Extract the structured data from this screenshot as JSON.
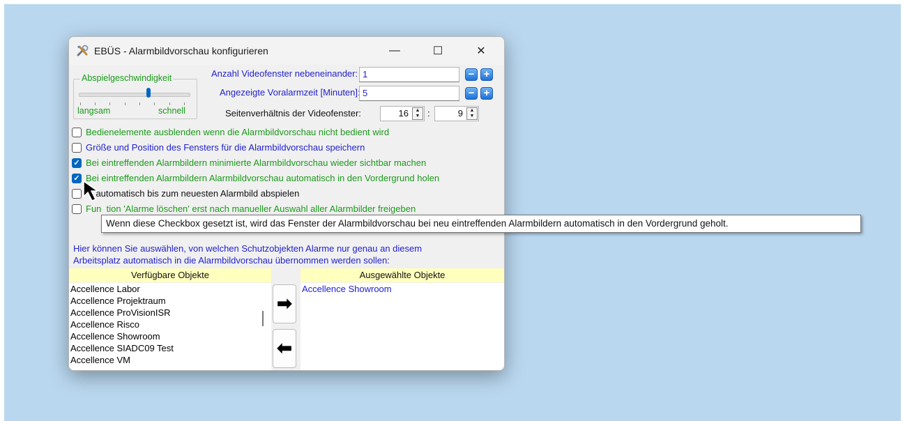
{
  "window": {
    "title": "EBÜS - Alarmbildvorschau konfigurieren",
    "minimize_label": "—",
    "maximize_label": "☐",
    "close_label": "✕"
  },
  "playback": {
    "group_label": "Abspielgeschwindigkeit",
    "slow_label": "langsam",
    "fast_label": "schnell",
    "slider_value_fraction": 0.63
  },
  "fields": {
    "video_windows_label": "Anzahl Videofenster nebeneinander:",
    "video_windows_value": "1",
    "prealarm_label": "Angezeigte Voralarmzeit [Minuten]:",
    "prealarm_value": "5",
    "aspect_label": "Seitenverhältnis der Videofenster:",
    "aspect_width": "16",
    "aspect_sep": ":",
    "aspect_height": "9",
    "minus_label": "−",
    "plus_label": "+"
  },
  "checkboxes": [
    {
      "label": "Bedienelemente ausblenden wenn die Alarmbildvorschau nicht bedient wird",
      "checked": false,
      "color": "green"
    },
    {
      "label": "Größe und Position des Fensters für die Alarmbildvorschau speichern",
      "checked": false,
      "color": "blue"
    },
    {
      "label": "Bei eintreffenden Alarmbildern minimierte Alarmbildvorschau wieder sichtbar machen",
      "checked": true,
      "color": "green"
    },
    {
      "label": "Bei eintreffenden Alarmbildern Alarmbildvorschau automatisch in den Vordergrund holen",
      "checked": true,
      "color": "green"
    },
    {
      "label": "    automatisch bis zum neuesten Alarmbild abspielen",
      "checked": false,
      "color": "dark"
    },
    {
      "label": "Fun  tion 'Alarme löschen' erst nach manueller Auswahl aller Alarmbilder freigeben",
      "checked": false,
      "color": "green"
    }
  ],
  "objects": {
    "intro_line1": "Hier können Sie auswählen, von welchen Schutzobjekten Alarme nur genau an diesem",
    "intro_line2": "Arbeitsplatz automatisch in die Alarmbildvorschau übernommen werden sollen:",
    "available_header": "Verfügbare Objekte",
    "selected_header": "Ausgewählte Objekte",
    "available": [
      "Accellence Labor",
      "Accellence Projektraum",
      "Accellence ProVisionISR",
      "Accellence Risco",
      "Accellence Showroom",
      "Accellence SIADC09 Test",
      "Accellence VM"
    ],
    "selected": [
      "Accellence Showroom"
    ],
    "add_arrow": "➡",
    "remove_arrow": "⬅"
  },
  "tooltip": {
    "text": "Wenn diese Checkbox gesetzt ist, wird das Fenster der Alarmbildvorschau bei neu eintreffenden Alarmbildern automatisch in den Vordergrund geholt."
  },
  "colors": {
    "desktop": "#b9d7ef",
    "green_text": "#1a9a1a",
    "blue_text": "#2222cc",
    "header_bg": "#ffffbe",
    "accent": "#0067c0"
  }
}
